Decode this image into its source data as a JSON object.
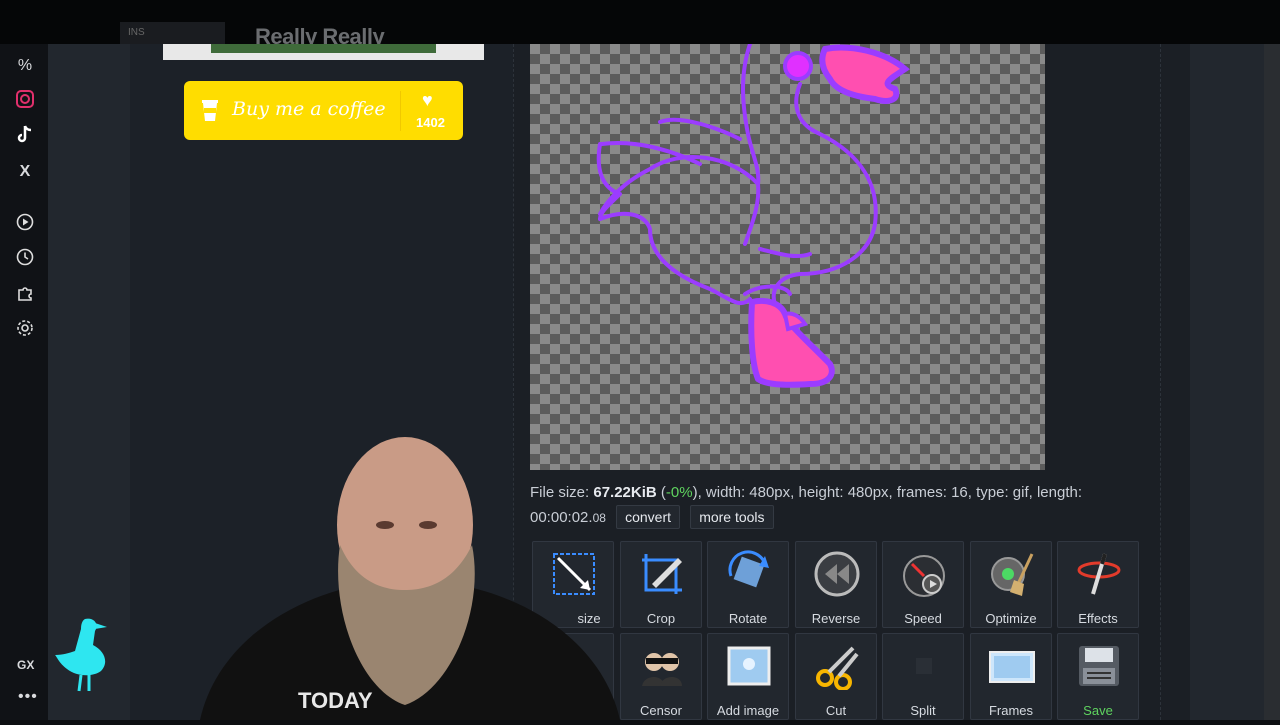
{
  "browser": {
    "tab_title": "Really Really",
    "tab_thumb": "INS"
  },
  "sidebar": {
    "items": [
      {
        "icon": "percent-icon",
        "glyph": "%"
      },
      {
        "icon": "instagram-icon"
      },
      {
        "icon": "tiktok-icon"
      },
      {
        "icon": "x-icon",
        "glyph": "X"
      },
      {
        "icon": "play-icon"
      },
      {
        "icon": "history-icon"
      },
      {
        "icon": "extensions-icon"
      },
      {
        "icon": "settings-icon"
      }
    ],
    "gx_label": "GX",
    "more_label": "•••"
  },
  "support": {
    "coffee_label": "Buy me a coffee",
    "coffee_count": "1402"
  },
  "file_info": {
    "size_label": "File size:",
    "size_value": "67.22KiB",
    "size_change": "-0%",
    "rest": ", width: 480px, height: 480px, frames: 16, type: gif, length:",
    "length_main": "00:00:02.",
    "length_ms": "08",
    "convert_label": "convert",
    "more_tools_label": "more tools"
  },
  "tools": {
    "row1": [
      "Resize",
      "Crop",
      "Rotate",
      "Reverse",
      "Speed",
      "Optimize",
      "Effects"
    ],
    "row2": [
      "Censor",
      "Add image",
      "Cut",
      "Split",
      "Frames",
      "Save"
    ],
    "resize_visible": "size"
  },
  "colors": {
    "accent_yellow": "#ffdd00",
    "gif_outline": "#9b3cff",
    "gif_fill": "#ff4fb0",
    "save_green": "#5fd35f"
  }
}
